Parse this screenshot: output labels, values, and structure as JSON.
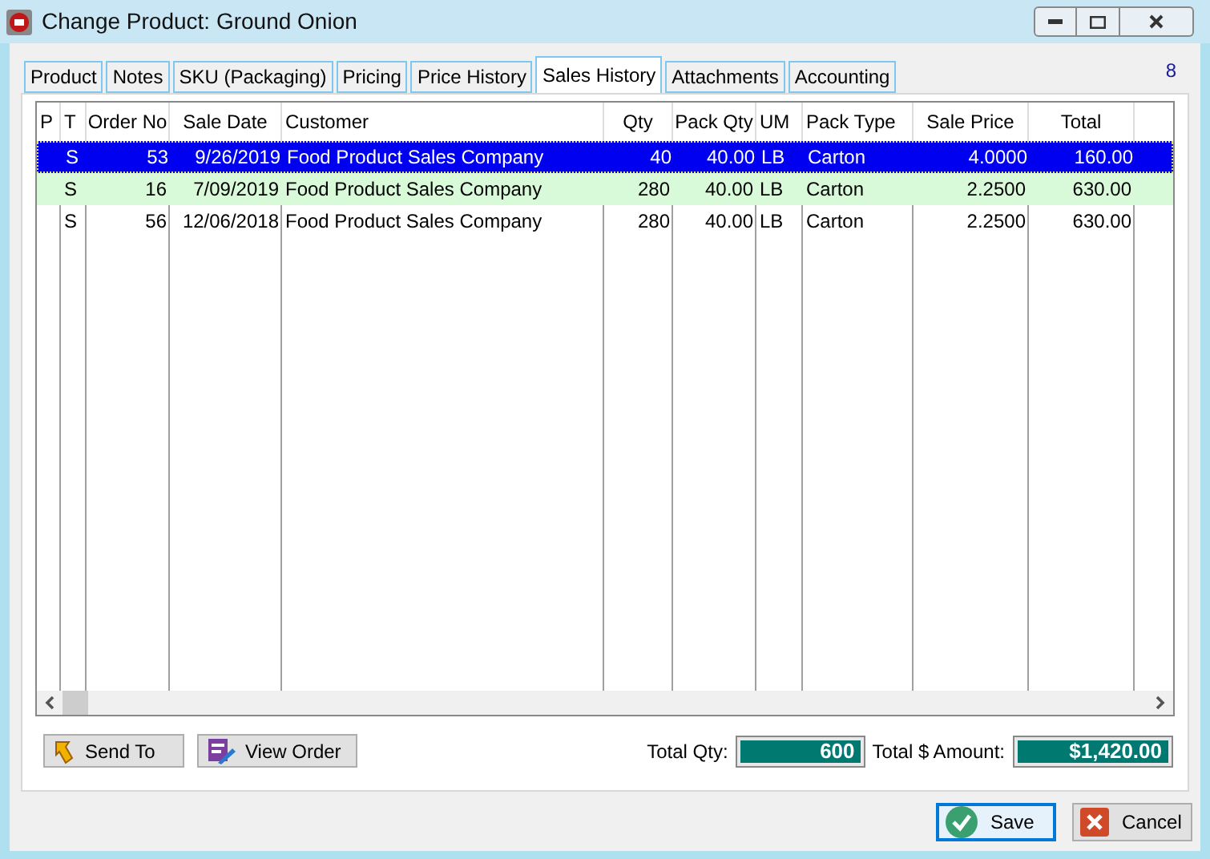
{
  "window": {
    "title": "Change Product: Ground Onion"
  },
  "tabs": [
    {
      "label": "Product",
      "selected": false
    },
    {
      "label": "Notes",
      "selected": false
    },
    {
      "label": "SKU (Packaging)",
      "selected": false
    },
    {
      "label": "Pricing",
      "selected": false
    },
    {
      "label": "Price History",
      "selected": false
    },
    {
      "label": "Sales History",
      "selected": true
    },
    {
      "label": "Attachments",
      "selected": false
    },
    {
      "label": "Accounting",
      "selected": false
    }
  ],
  "record_count": "8",
  "table": {
    "columns": [
      "P",
      "T",
      "Order No",
      "Sale Date",
      "Customer",
      "Qty",
      "Pack Qty",
      "UM",
      "Pack Type",
      "Sale Price",
      "Total"
    ],
    "rows": [
      {
        "cells": [
          "",
          "S",
          "53",
          "9/26/2019",
          "Food Product Sales Company",
          "40",
          "40.00",
          "LB",
          "Carton",
          "4.0000",
          "160.00"
        ],
        "selected": true,
        "highlighted": false
      },
      {
        "cells": [
          "",
          "S",
          "16",
          "7/09/2019",
          "Food Product Sales Company",
          "280",
          "40.00",
          "LB",
          "Carton",
          "2.2500",
          "630.00"
        ],
        "selected": false,
        "highlighted": true
      },
      {
        "cells": [
          "",
          "S",
          "56",
          "12/06/2018",
          "Food Product Sales Company",
          "280",
          "40.00",
          "LB",
          "Carton",
          "2.2500",
          "630.00"
        ],
        "selected": false,
        "highlighted": false
      }
    ]
  },
  "buttons": [
    {
      "label": "Send To",
      "kind": "send"
    },
    {
      "label": "View Order",
      "kind": "view"
    }
  ],
  "totals": [
    {
      "label": "Total Qty:",
      "value": "600"
    },
    {
      "label": "Total $ Amount:",
      "value": "$1,420.00"
    }
  ],
  "footer_buttons": [
    {
      "label": "Save",
      "kind": "save",
      "focused": true
    },
    {
      "label": "Cancel",
      "kind": "cancel",
      "focused": false
    }
  ]
}
